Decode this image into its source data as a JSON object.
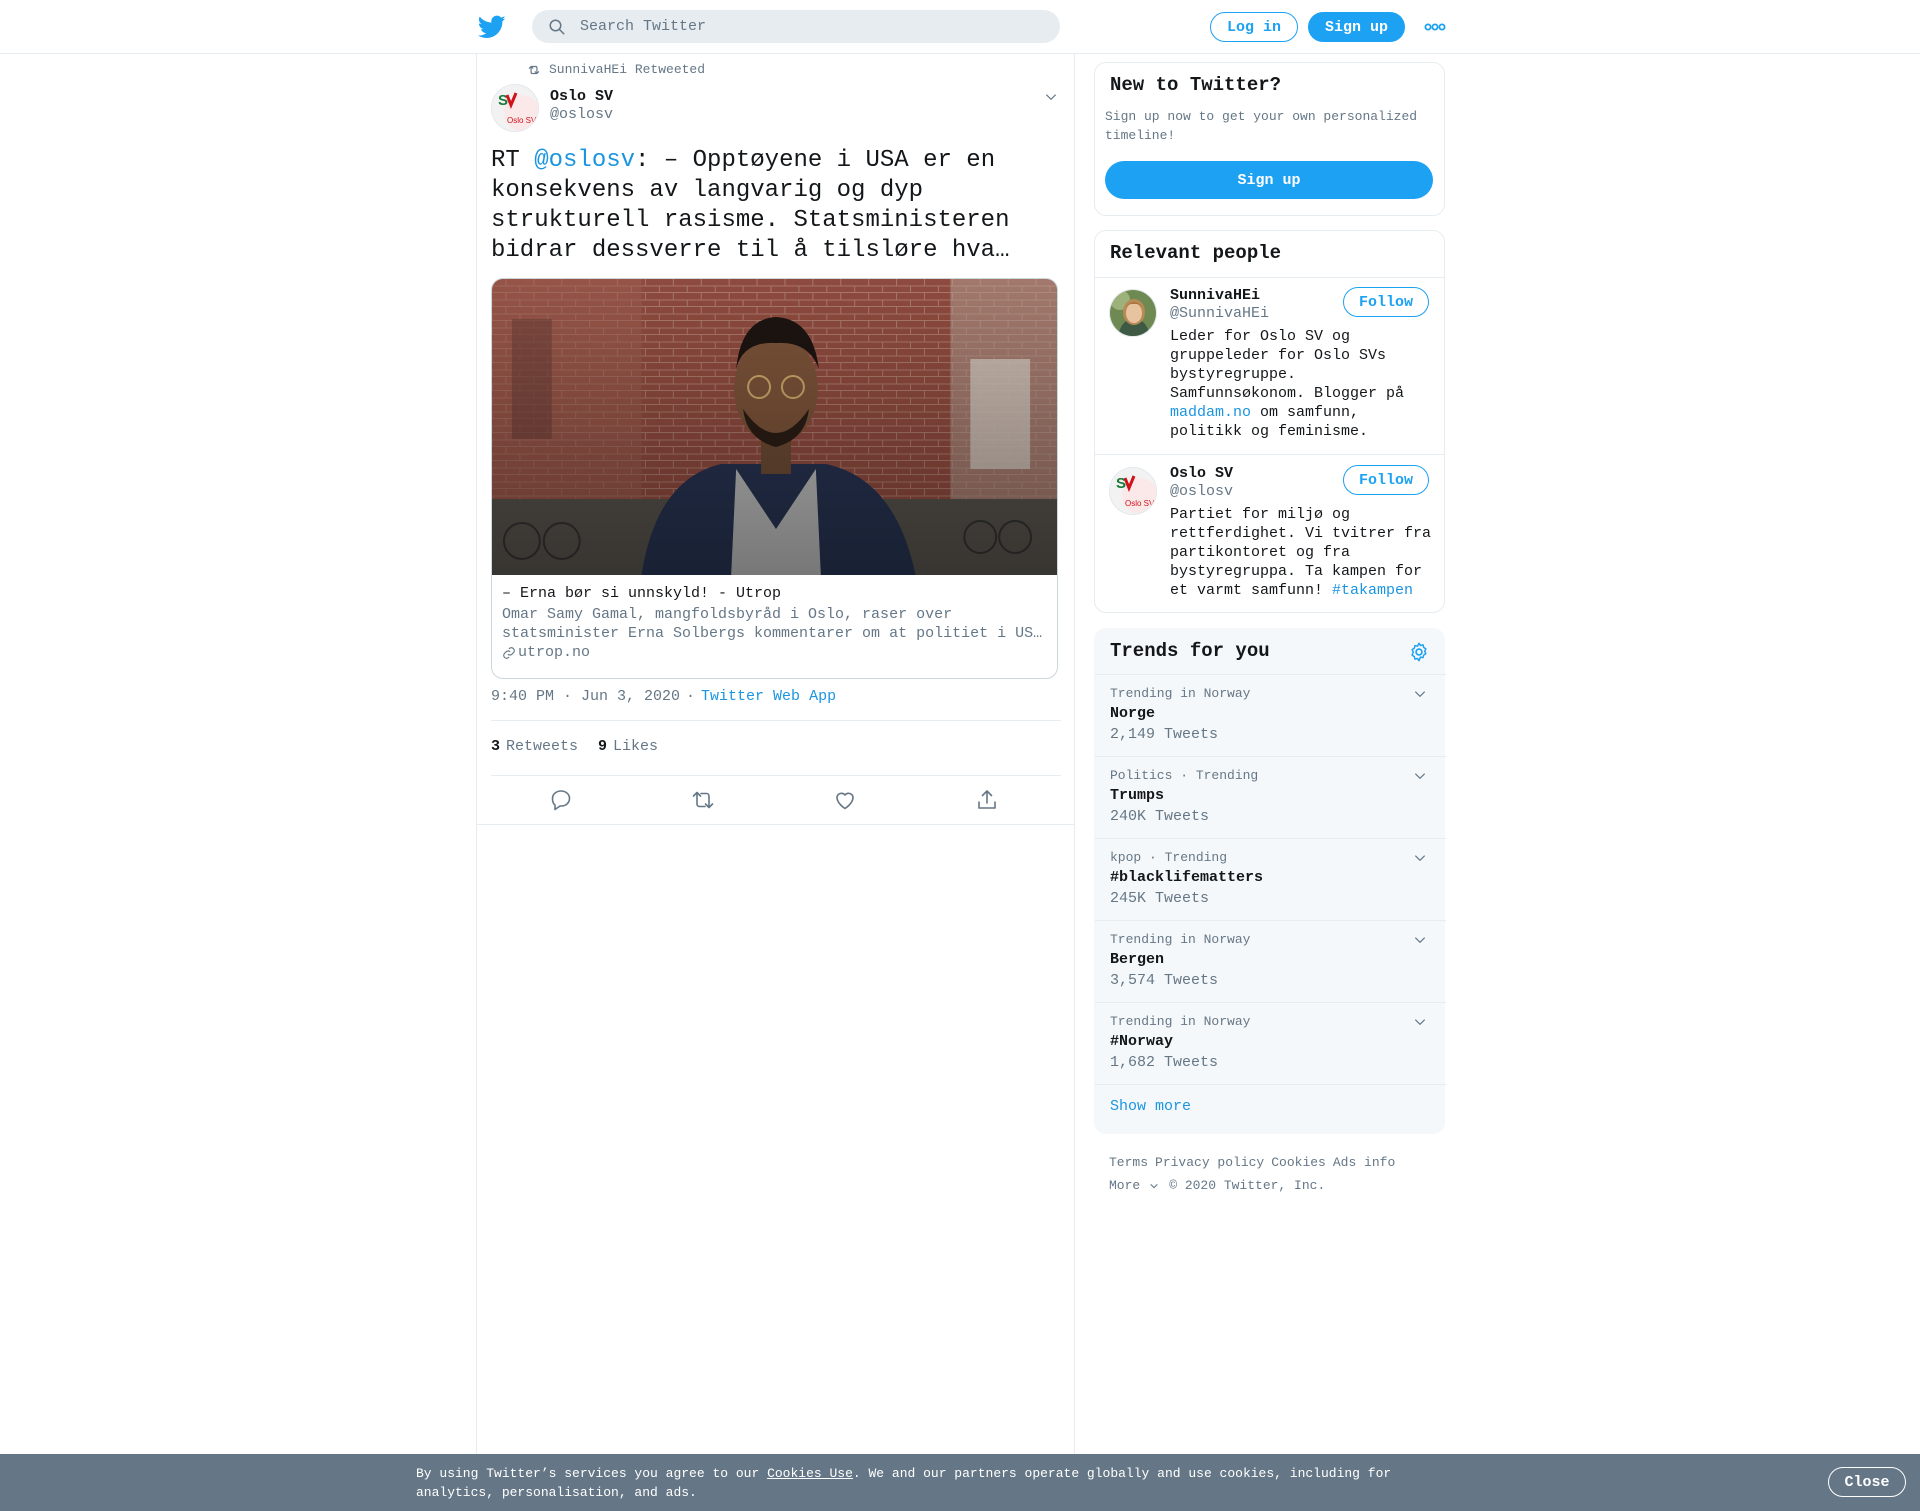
{
  "header": {
    "search_placeholder": "Search Twitter",
    "login_label": "Log in",
    "signup_label": "Sign up"
  },
  "tweet": {
    "retweeted_by": "SunnivaHEi Retweeted",
    "author_name": "Oslo SV",
    "author_handle": "@oslosv",
    "text_prefix": "RT ",
    "text_mention": "@oslosv",
    "text_body": ": – Opptøyene i USA er en konsekvens av langvarig og dyp strukturell rasisme. Statsministeren bidrar dessverre til å tilsløre hva…",
    "card": {
      "title": "– Erna bør si unnskyld! - Utrop",
      "desc_line1": "Omar Samy Gamal, mangfoldsbyråd i Oslo, raser over",
      "desc_line2": "statsminister Erna Solbergs kommentarer om at politiet i US…",
      "domain": "utrop.no"
    },
    "time": "9:40 PM · Jun 3, 2020",
    "separator": "·",
    "source": "Twitter Web App",
    "retweets_count": "3",
    "retweets_label": "Retweets",
    "likes_count": "9",
    "likes_label": "Likes"
  },
  "new_to_twitter": {
    "title": "New to Twitter?",
    "desc": "Sign up now to get your own personalized timeline!",
    "signup_label": "Sign up"
  },
  "relevant_people": {
    "title": "Relevant people",
    "people": [
      {
        "name": "SunnivaHEi",
        "handle": "@SunnivaHEi",
        "follow_label": "Follow",
        "bio_before": "Leder for Oslo SV og gruppeleder for Oslo SVs bystyregruppe. Samfunnsøkonom. Blogger på ",
        "bio_link": "maddam.no",
        "bio_after": " om samfunn, politikk og feminisme."
      },
      {
        "name": "Oslo SV",
        "handle": "@oslosv",
        "follow_label": "Follow",
        "bio_before": "Partiet for miljø og rettferdighet. Vi tvitrer fra partikontoret og fra bystyregruppa. Ta kampen for et varmt samfunn! ",
        "bio_link": "#takampen",
        "bio_after": ""
      }
    ]
  },
  "trends": {
    "title": "Trends for you",
    "items": [
      {
        "context": "Trending in Norway",
        "name": "Norge",
        "count": "2,149 Tweets"
      },
      {
        "context": "Politics · Trending",
        "name": "Trumps",
        "count": "240K Tweets"
      },
      {
        "context": "kpop · Trending",
        "name": "#blacklifematters",
        "count": "245K Tweets"
      },
      {
        "context": "Trending in Norway",
        "name": "Bergen",
        "count": "3,574 Tweets"
      },
      {
        "context": "Trending in Norway",
        "name": "#Norway",
        "count": "1,682 Tweets"
      }
    ],
    "show_more": "Show more"
  },
  "footer": {
    "links": [
      "Terms",
      "Privacy policy",
      "Cookies",
      "Ads info"
    ],
    "more_label": "More",
    "copyright": "© 2020 Twitter, Inc."
  },
  "cookie_bar": {
    "text_before": "By using Twitter’s services you agree to our ",
    "link": "Cookies Use",
    "text_after": ". We and our partners operate globally and use cookies, including for analytics, personalisation, and ads.",
    "close_label": "Close"
  },
  "colors": {
    "brand": "#1da1f2",
    "link": "#1b95e0",
    "muted": "#657786",
    "cookie_bar": "#657786"
  }
}
